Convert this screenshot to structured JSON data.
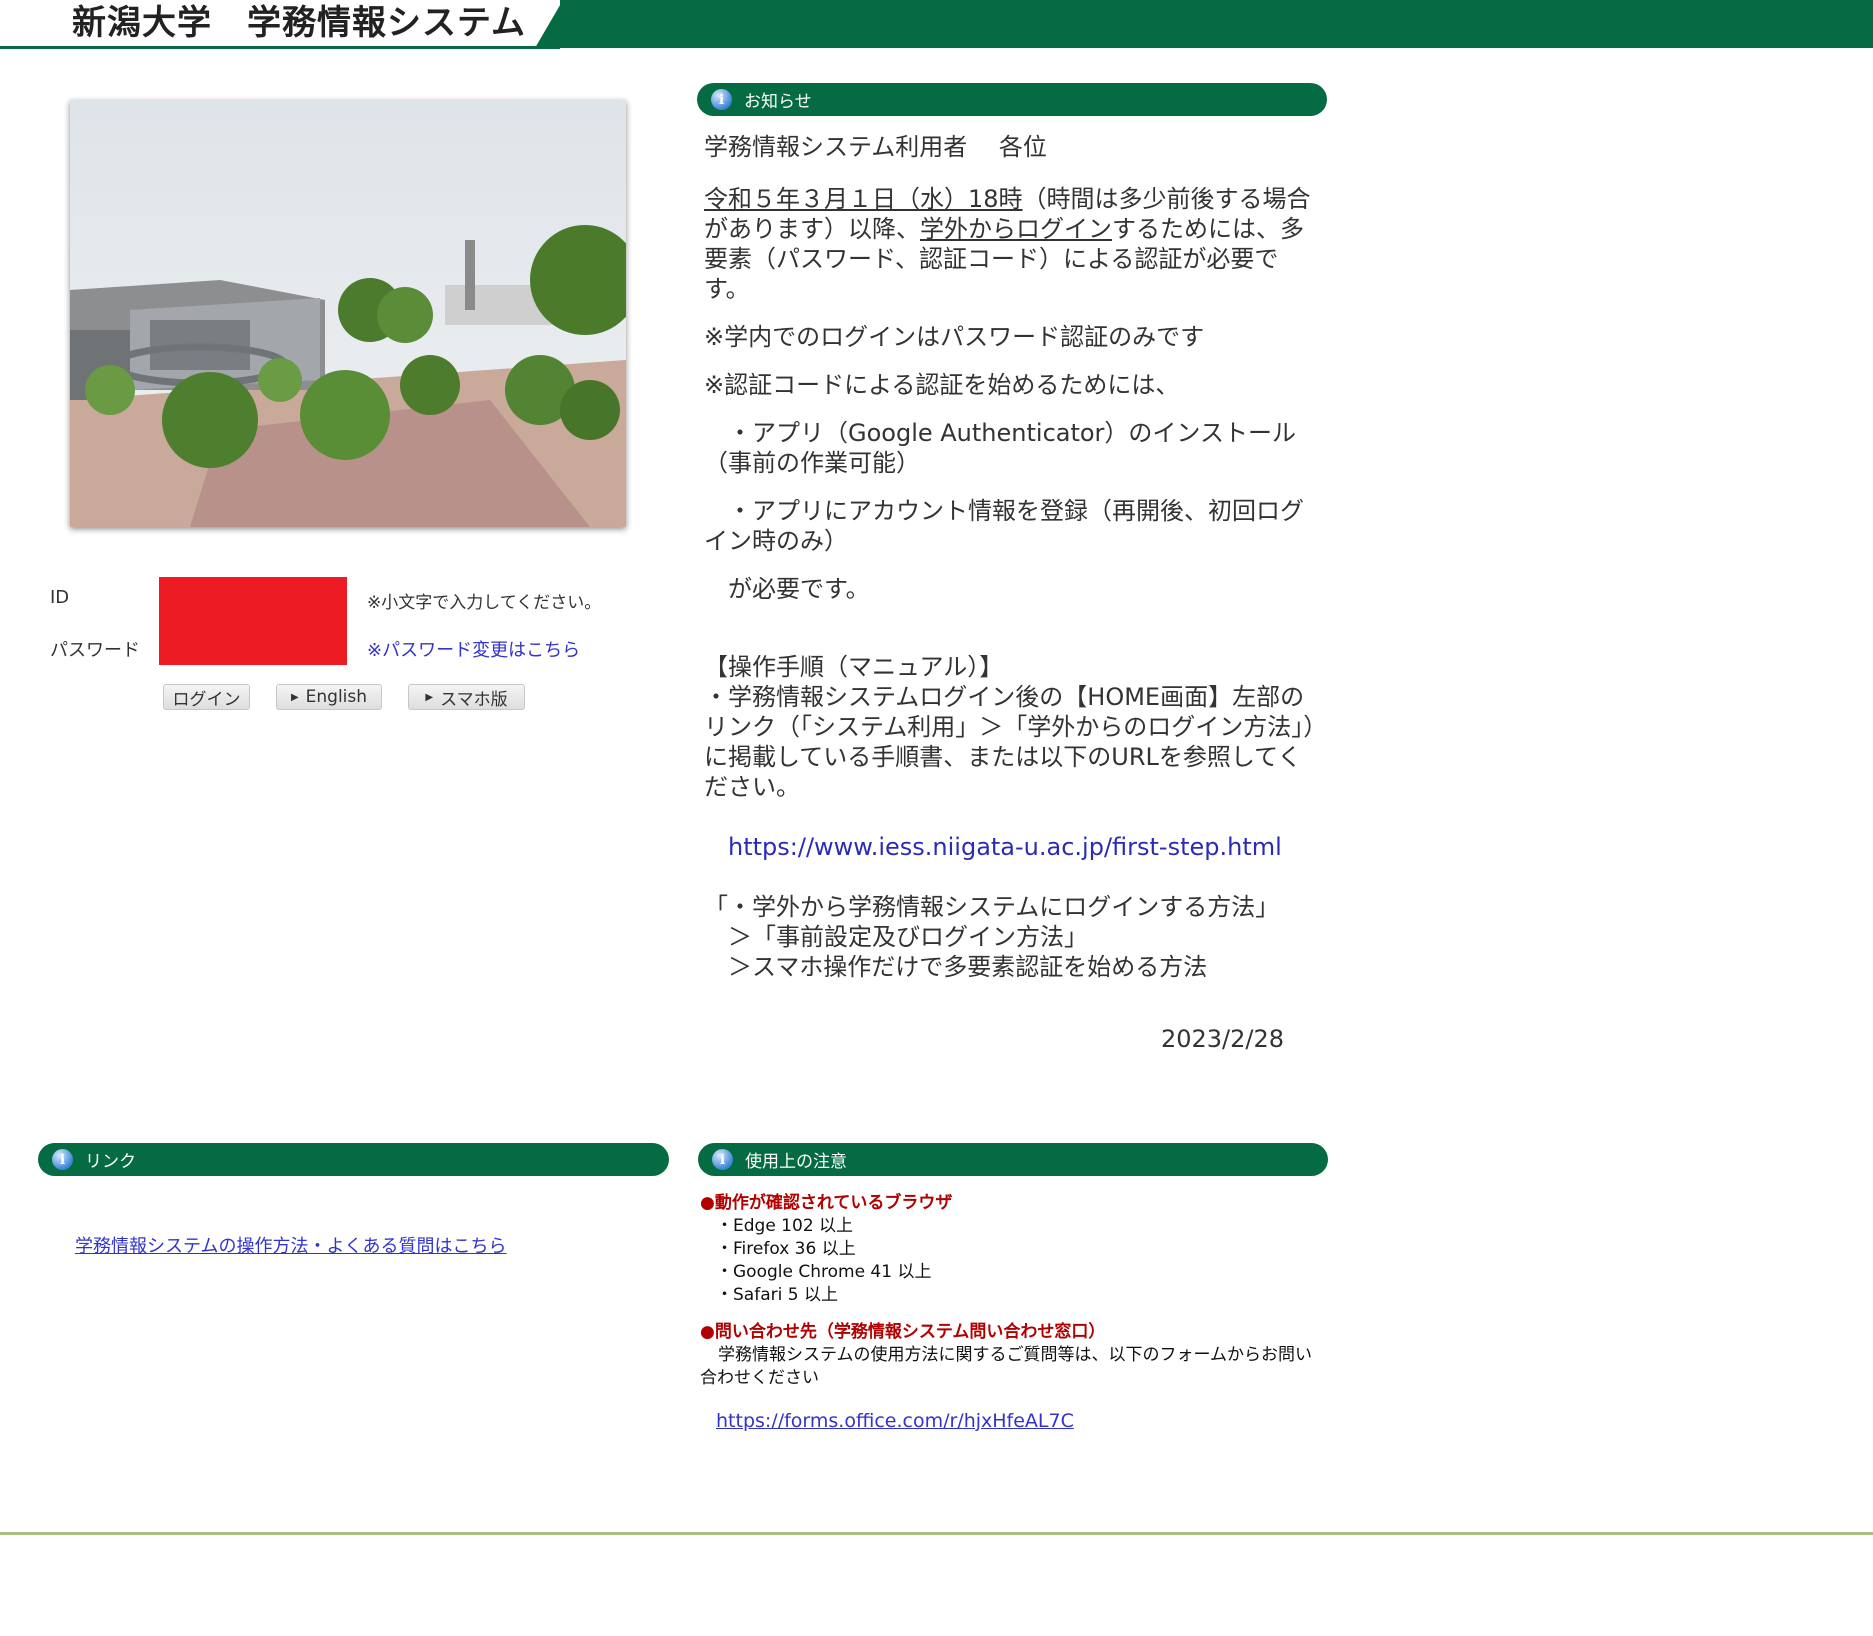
{
  "header": {
    "title": "新潟大学　学務情報システム"
  },
  "photo": {
    "alt": "campus-photo"
  },
  "login": {
    "id_label": "ID",
    "password_label": "パスワード",
    "id_hint": "※小文字で入力してください。",
    "password_change_link": "※パスワード変更はこちら",
    "login_button": "ログイン",
    "english_button": "English",
    "smartphone_button": "スマホ版"
  },
  "notice": {
    "title": "お知らせ",
    "addressee": "学務情報システム利用者　 各位",
    "p1_underlined": "令和５年３月１日（水）18時",
    "p1_a": "（時間は多少前後する場合があります）以降、",
    "p1_link": "学外からログイン",
    "p1_b": "するためには、多要素（パスワード、認証コード）による認証が必要です。",
    "p2": "※学内でのログインはパスワード認証のみです",
    "p3": "※認証コードによる認証を始めるためには、",
    "p4": "・アプリ（Google Authenticator）のインストール（事前の作業可能）",
    "p5": "・アプリにアカウント情報を登録（再開後、初回ログイン時のみ）",
    "p6": "が必要です。",
    "manual_head": "【操作手順（マニュアル）】",
    "manual_body": "・学務情報システムログイン後の【HOME画面】左部のリンク（「システム利用」＞「学外からのログイン方法」）に掲載している手順書、または以下のURLを参照してください。",
    "url": "https://www.iess.niigata-u.ac.jp/first-step.html",
    "path1": "「・学外から学務情報システムにログインする方法」",
    "path2": "＞「事前設定及びログイン方法」",
    "path3": "＞スマホ操作だけで多要素認証を始める方法",
    "date": "2023/2/28"
  },
  "links": {
    "title": "リンク",
    "faq": "学務情報システムの操作方法・よくある質問はこちら"
  },
  "notes": {
    "title": "使用上の注意",
    "browsers_head": "●動作が確認されているブラウザ",
    "browsers": [
      "・Edge 102 以上",
      "・Firefox 36 以上",
      "・Google Chrome 41 以上",
      "・Safari 5 以上"
    ],
    "contact_head": "●問い合わせ先（学務情報システム問い合わせ窓口）",
    "contact_body": "学務情報システムの使用方法に関するご質問等は、以下のフォームからお問い合わせください",
    "form_url": "https://forms.office.com/r/hjxHfeAL7C"
  },
  "colors": {
    "brand_green": "#046b43",
    "link_blue": "#3333cc",
    "note_red": "#b00000"
  }
}
